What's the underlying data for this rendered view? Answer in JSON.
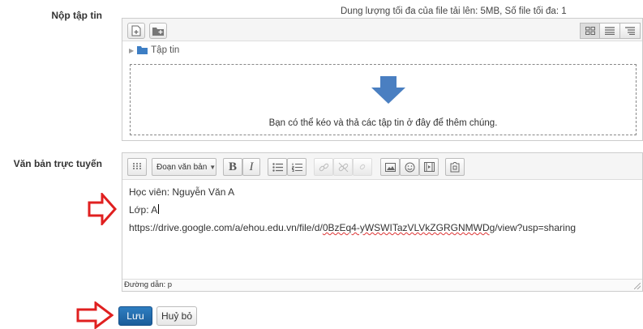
{
  "file_submission": {
    "label": "Nộp tập tin",
    "limits_text": "Dung lượng tối đa của file tải lên: 5MB, Số file tối đa: 1",
    "path_folder": "Tập tin",
    "drop_text": "Bạn có thể kéo và thả các tập tin ở đây để thêm chúng."
  },
  "online_text": {
    "label": "Văn bản trực tuyến",
    "format_select": "Đoạn văn bản",
    "toolbar_icons": [
      "toggle-icon",
      "bold-icon",
      "italic-icon",
      "bullet-list-icon",
      "numbered-list-icon",
      "link-icon",
      "unlink-icon",
      "anchor-icon",
      "image-icon",
      "emoticon-icon",
      "media-icon",
      "file-manager-icon"
    ],
    "lines": {
      "line1": "Học viên: Nguyễn Văn A",
      "line2": "Lớp: A",
      "link_prefix": "https://drive.google.com/a/ehou.edu.vn/file/d/",
      "link_rest": "0BzEq4-yWSWITazVLVkZGRGNMWDg",
      "link_suffix": "/view?usp=sharing"
    },
    "status_path": "Đường dẫn: p"
  },
  "actions": {
    "save": "Lưu",
    "cancel": "Huỷ bỏ"
  },
  "colors": {
    "primary_button": "#1f65a6",
    "annotation_arrow": "#e02020",
    "drop_arrow": "#4a7fc1"
  }
}
